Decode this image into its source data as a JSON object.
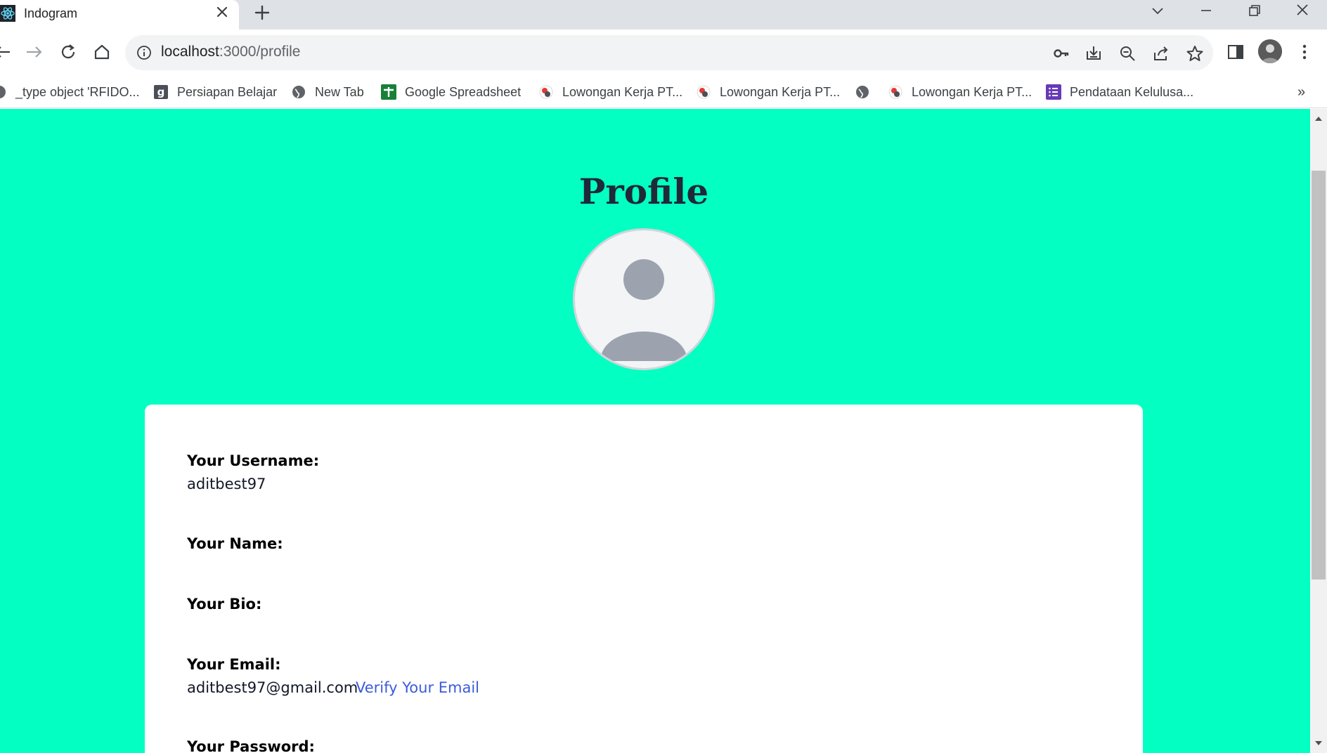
{
  "browser": {
    "tab_title": "Indogram",
    "url_host": "localhost",
    "url_path": ":3000/profile",
    "bookmarks": [
      {
        "label": "_type object 'RFIDO...",
        "icon": "globe-icon"
      },
      {
        "label": "Persiapan Belajar",
        "icon": "g-letter-icon"
      },
      {
        "label": "New Tab",
        "icon": "globe-icon"
      },
      {
        "label": "Google Spreadsheet",
        "icon": "sheets-icon"
      },
      {
        "label": "Lowongan Kerja PT...",
        "icon": "job-site-icon"
      },
      {
        "label": "Lowongan Kerja PT...",
        "icon": "job-site-icon"
      },
      {
        "label": "",
        "icon": "globe-icon"
      },
      {
        "label": "Lowongan Kerja PT...",
        "icon": "job-site-icon"
      },
      {
        "label": "Pendataan Kelulusa...",
        "icon": "forms-icon"
      }
    ],
    "bookmarks_overflow": "»"
  },
  "page": {
    "title": "Profile",
    "fields": {
      "username_label": "Your Username:",
      "username_value": "aditbest97",
      "name_label": "Your Name:",
      "bio_label": "Your Bio:",
      "email_label": "Your Email:",
      "email_value": "aditbest97@gmail.com",
      "verify_link": "Verify Your Email",
      "password_label": "Your Password:"
    }
  },
  "colors": {
    "page_background": "#04ffc3",
    "title": "#1f2937",
    "link": "#3b5bdb",
    "avatar_placeholder": "#9ca3af"
  }
}
